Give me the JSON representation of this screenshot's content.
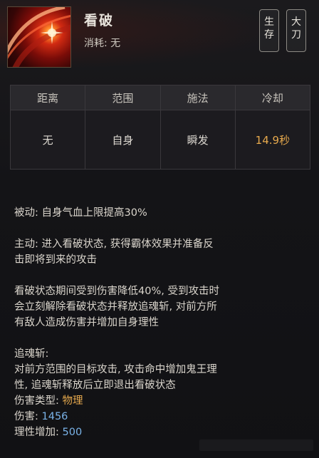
{
  "skill": {
    "name": "看破",
    "cost_label": "消耗:",
    "cost_value": "无",
    "icon": "slash-flare-icon",
    "tags": [
      {
        "chars": [
          "生",
          "存"
        ]
      },
      {
        "chars": [
          "大",
          "刀"
        ]
      }
    ]
  },
  "stats": {
    "headers": [
      "距离",
      "范围",
      "施法",
      "冷却"
    ],
    "values": [
      "无",
      "自身",
      "瞬发",
      "14.9秒"
    ]
  },
  "description": {
    "passive": "被动: 自身气血上限提高30%",
    "active_line1": "主动: 进入看破状态, 获得霸体效果并准备反",
    "active_line2": "击即将到来的攻击",
    "state_line1": "看破状态期间受到伤害降低40%, 受到攻击时",
    "state_line2": "会立刻解除看破状态并释放追魂斩, 对前方所",
    "state_line3": "有敌人造成伤害并增加自身理性",
    "sub_title": "追魂斩:",
    "sub_line1": "对前方范围的目标攻击, 攻击命中增加鬼王理",
    "sub_line2": "性, 追魂斩释放后立即退出看破状态",
    "damage_type_label": "伤害类型:",
    "damage_type_value": "物理",
    "damage_label": "伤害:",
    "damage_value": "1456",
    "reason_label": "理性增加:",
    "reason_value": "500"
  },
  "colors": {
    "accent": "#e6a94d",
    "text": "#dad5cc",
    "value_blue": "#7ab3e8",
    "background": "#141417"
  }
}
